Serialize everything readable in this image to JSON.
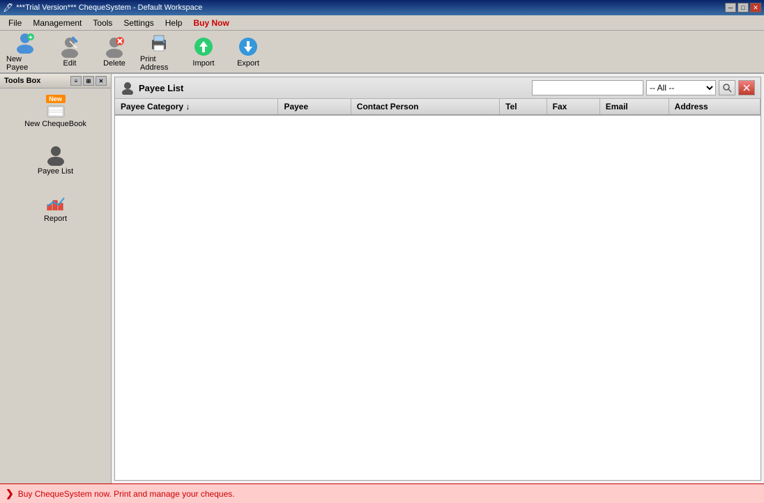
{
  "titlebar": {
    "title": "***Trial Version*** ChequeSystem - Default Workspace",
    "controls": [
      "minimize",
      "maximize",
      "close"
    ]
  },
  "menubar": {
    "items": [
      "File",
      "Management",
      "Tools",
      "Settings",
      "Help",
      "Buy Now"
    ]
  },
  "toolbar": {
    "buttons": [
      {
        "id": "new-payee",
        "label": "New Payee",
        "icon": "new-payee-icon"
      },
      {
        "id": "edit",
        "label": "Edit",
        "icon": "edit-icon"
      },
      {
        "id": "delete",
        "label": "Delete",
        "icon": "delete-icon"
      },
      {
        "id": "print-address",
        "label": "Print Address",
        "icon": "print-icon"
      },
      {
        "id": "import",
        "label": "Import",
        "icon": "import-icon"
      },
      {
        "id": "export",
        "label": "Export",
        "icon": "export-icon"
      }
    ]
  },
  "toolsbox": {
    "title": "Tools Box",
    "items": [
      {
        "id": "new-chequebook",
        "label": "New ChequeBook",
        "icon": "new-chequebook-icon"
      },
      {
        "id": "payee-list",
        "label": "Payee List",
        "icon": "payee-list-icon"
      },
      {
        "id": "report",
        "label": "Report",
        "icon": "report-icon"
      }
    ]
  },
  "payeepanel": {
    "title": "Payee List",
    "search_placeholder": "",
    "category_options": [
      "-- All --"
    ],
    "selected_category": "-- All --",
    "columns": [
      "Payee Category ↓",
      "Payee",
      "Contact Person",
      "Tel",
      "Fax",
      "Email",
      "Address"
    ],
    "rows": []
  },
  "statusbar": {
    "message": "Buy ChequeSystem now. Print and manage your cheques.",
    "icon": "❯"
  }
}
